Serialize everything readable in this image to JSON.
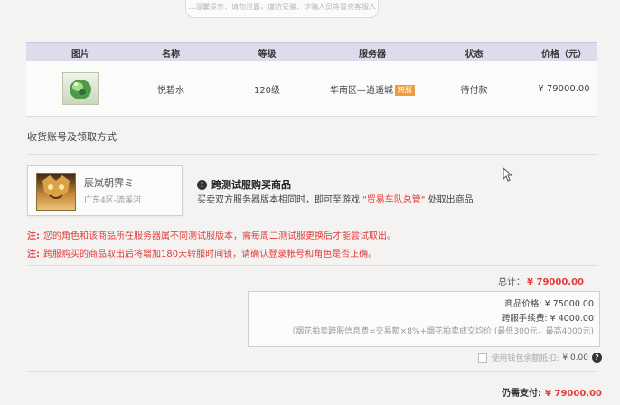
{
  "top_tip": "…温馨提示：请勿泄露，谨防受骗、诈骗人员等冒充客服人员联系你…",
  "table": {
    "headers": [
      "图片",
      "名称",
      "等级",
      "服务器",
      "状态",
      "价格（元）"
    ],
    "row": {
      "name": "悦碧水",
      "level": "120级",
      "server": "华南区—逍遥城",
      "server_tag": "跨服",
      "status": "待付款",
      "price": "¥ 79000.00"
    }
  },
  "section_title": "收货账号及领取方式",
  "character": {
    "name": "辰岚朝霁ミ",
    "server": "广东4区-流溪河"
  },
  "notice": {
    "title": "跨测试服购买商品",
    "text_before": "买卖双方服务器版本相同时，即可至游戏 ",
    "highlight": "\"贸易车队总管\"",
    "text_after": " 处取出商品"
  },
  "warnings": [
    {
      "prefix": "注:",
      "text": "您的角色和该商品所在服务器属不同测试服版本，需每周二测试服更换后才能尝试取出。"
    },
    {
      "prefix": "注:",
      "text": "跨服购买的商品取出后将增加180天转服时间锁，请确认登录帐号和角色是否正确。"
    }
  ],
  "total": {
    "label": "总计：",
    "value": "¥ 79000.00"
  },
  "fees": {
    "price_label": "商品价格:",
    "price_value": "¥ 75000.00",
    "fee_label": "跨服手续费:",
    "fee_value": "¥ 4000.00",
    "note": "（烟花拍卖跨服信息费=交易额×8%+烟花拍卖成交均价 (最低300元，最高4000元)"
  },
  "coupon": {
    "label": "使用钱包余额抵扣:",
    "value": "¥ 0.00"
  },
  "pay": {
    "label": "仍需支付:",
    "value": "¥ 79000.00"
  },
  "colors": {
    "accent_red": "#e23b3b",
    "header_bg": "#dddcec",
    "tag_orange": "#f19a3e"
  }
}
